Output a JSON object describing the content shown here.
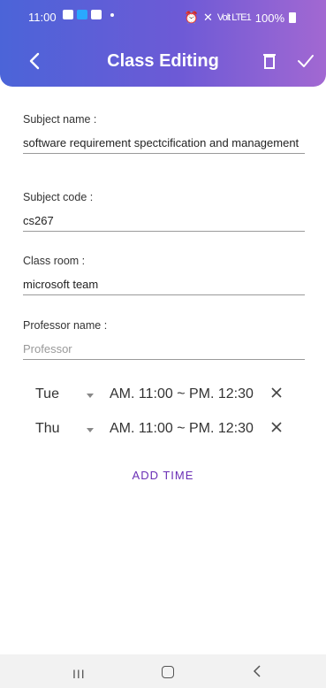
{
  "status_bar": {
    "time": "11:00",
    "battery": "100%",
    "signal_text": "Volt LTE1"
  },
  "app_bar": {
    "title": "Class Editing",
    "icons": [
      "back-icon",
      "trash-icon",
      "check-icon"
    ]
  },
  "form": {
    "subject_name": {
      "label": "Subject name :",
      "value": "software requirement spectcification and management"
    },
    "subject_code": {
      "label": "Subject code :",
      "value": "cs267"
    },
    "class_room": {
      "label": "Class room :",
      "value": "microsoft team"
    },
    "professor_name": {
      "label": "Professor name :",
      "placeholder": "Professor"
    }
  },
  "times": [
    {
      "day": "Tue",
      "range": "AM. 11:00 ~ PM. 12:30"
    },
    {
      "day": "Thu",
      "range": "AM. 11:00 ~ PM. 12:30"
    }
  ],
  "add_time_label": "ADD TIME",
  "nav_bar": {
    "recent_label": "III"
  },
  "colors": {
    "gradient_start": "#4b64d8",
    "gradient_end": "#a268d2",
    "accent": "#6a2fb5"
  }
}
